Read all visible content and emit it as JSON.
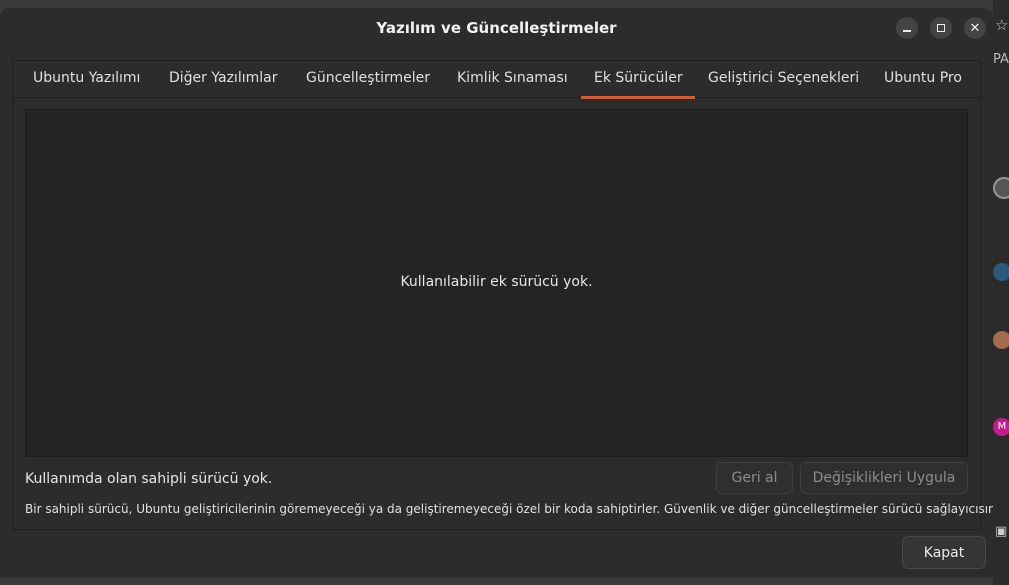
{
  "window": {
    "title": "Yazılım ve Güncelleştirmeler"
  },
  "tabs": [
    {
      "label": "Ubuntu Yazılımı"
    },
    {
      "label": "Diğer Yazılımlar"
    },
    {
      "label": "Güncelleştirmeler"
    },
    {
      "label": "Kimlik Sınaması"
    },
    {
      "label": "Ek Sürücüler",
      "active": true
    },
    {
      "label": "Geliştirici Seçenekleri"
    },
    {
      "label": "Ubuntu Pro"
    }
  ],
  "drivers": {
    "empty_message": "Kullanılabilir ek sürücü yok.",
    "status": "Kullanımda olan sahipli sürücü yok.",
    "revert_label": "Geri al",
    "apply_label": "Değişiklikleri Uygula",
    "note": "Bir sahipli sürücü, Ubuntu geliştiricilerinin göremeyeceği ya da geliştiremeyeceği özel bir koda sahiptirler. Güvenlik ve diğer güncelleştirmeler sürücü sağlayıcısına bağlıdır."
  },
  "footer": {
    "close_label": "Kapat"
  },
  "background_fragments": {
    "partial_text": "PA",
    "avatar_letter": "M"
  },
  "colors": {
    "accent": "#e95420",
    "window_bg": "#2c2c2c",
    "panel_bg": "#242424"
  }
}
